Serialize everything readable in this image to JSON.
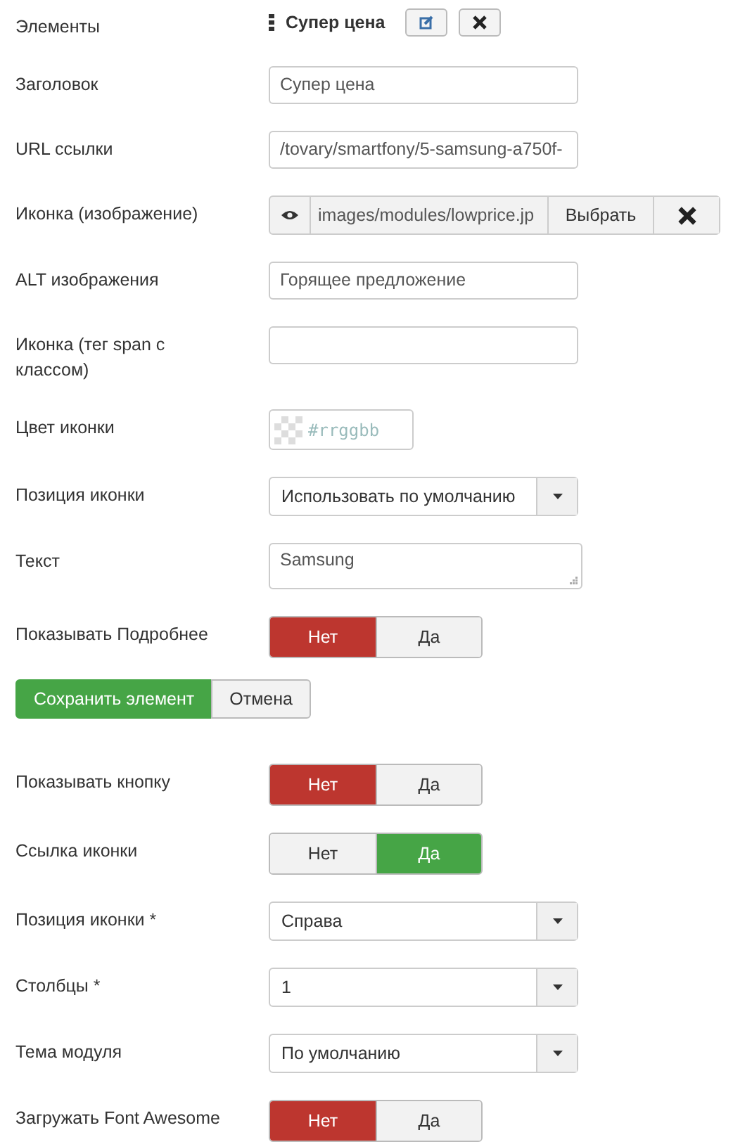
{
  "rows": [
    {
      "kind": "item",
      "label": "Элементы",
      "title": "Супер цена"
    },
    {
      "kind": "text",
      "label": "Заголовок",
      "value": "Супер цена"
    },
    {
      "kind": "text",
      "label": "URL ссылки",
      "value": "/tovary/smartfony/5-samsung-a750f-"
    },
    {
      "kind": "media",
      "label": "Иконка (изображение)",
      "value": "images/modules/lowprice.jp",
      "button": "Выбрать"
    },
    {
      "kind": "text",
      "label": "ALT изображения",
      "value": "Горящее предложение"
    },
    {
      "kind": "text",
      "label": "Иконка (тег span с классом)"
    },
    {
      "kind": "color",
      "label": "Цвет иконки",
      "placeholder": "#rrggbb"
    },
    {
      "kind": "select",
      "label": "Позиция иконки",
      "value": "Использовать по умолчанию"
    },
    {
      "kind": "textarea",
      "label": "Текст",
      "value": "Samsung"
    },
    {
      "kind": "toggle",
      "label": "Показывать Подробнее",
      "options": [
        {
          "label": "Нет",
          "kind": "no",
          "selected": true
        },
        {
          "label": "Да",
          "kind": "yes",
          "selected": false
        }
      ]
    },
    {
      "kind": "actions",
      "buttons": [
        {
          "label": "Сохранить элемент",
          "kind": "primary"
        },
        {
          "label": "Отмена",
          "kind": "default"
        }
      ]
    },
    {
      "kind": "toggle",
      "label": "Показывать кнопку",
      "options": [
        {
          "label": "Нет",
          "kind": "no",
          "selected": true
        },
        {
          "label": "Да",
          "kind": "yes",
          "selected": false
        }
      ]
    },
    {
      "kind": "toggle",
      "label": "Ссылка иконки",
      "options": [
        {
          "label": "Нет",
          "kind": "no",
          "selected": false
        },
        {
          "label": "Да",
          "kind": "yes",
          "selected": true
        }
      ]
    },
    {
      "kind": "select",
      "label": "Позиция иконки *",
      "value": "Справа"
    },
    {
      "kind": "select",
      "label": "Столбцы *",
      "value": "1"
    },
    {
      "kind": "select",
      "label": "Тема модуля",
      "value": "По умолчанию"
    },
    {
      "kind": "toggle",
      "label": "Загружать Font Awesome",
      "options": [
        {
          "label": "Нет",
          "kind": "no",
          "selected": true
        },
        {
          "label": "Да",
          "kind": "yes",
          "selected": false
        }
      ]
    }
  ]
}
